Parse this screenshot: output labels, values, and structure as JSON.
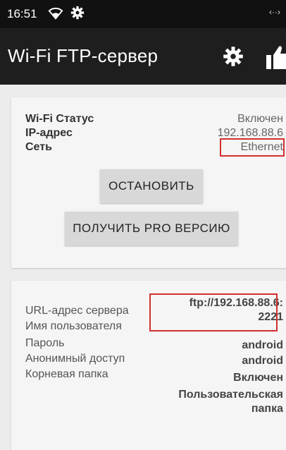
{
  "status_bar": {
    "time": "16:51",
    "right_indicator": "‹··›"
  },
  "app_bar": {
    "title": "Wi-Fi FTP-сервер",
    "icons": [
      "settings-icon",
      "thumb-up-icon"
    ]
  },
  "status_card": {
    "rows": [
      {
        "label": "Wi-Fi Статус",
        "value": "Включен"
      },
      {
        "label": "IP-адрес",
        "value": "192.168.88.6"
      },
      {
        "label": "Сеть",
        "value": "Ethernet"
      }
    ],
    "stop_button": "ОСТАНОВИТЬ",
    "pro_button": "ПОЛУЧИТЬ PRO ВЕРСИЮ"
  },
  "server_card": {
    "labels": {
      "url": "URL-адрес сервера",
      "username": "Имя пользователя",
      "password": "Пароль",
      "anonymous": "Анонимный доступ",
      "root": "Корневая папка"
    },
    "values": {
      "url_line1": "ftp://192.168.88.6:",
      "url_line2": "2221",
      "username": "android",
      "password": "android",
      "anonymous": "Включен",
      "root_line1": "Пользовательская",
      "root_line2": "папка"
    }
  },
  "colors": {
    "highlight": "#d32f2f",
    "appbar": "#1e1e1e"
  }
}
